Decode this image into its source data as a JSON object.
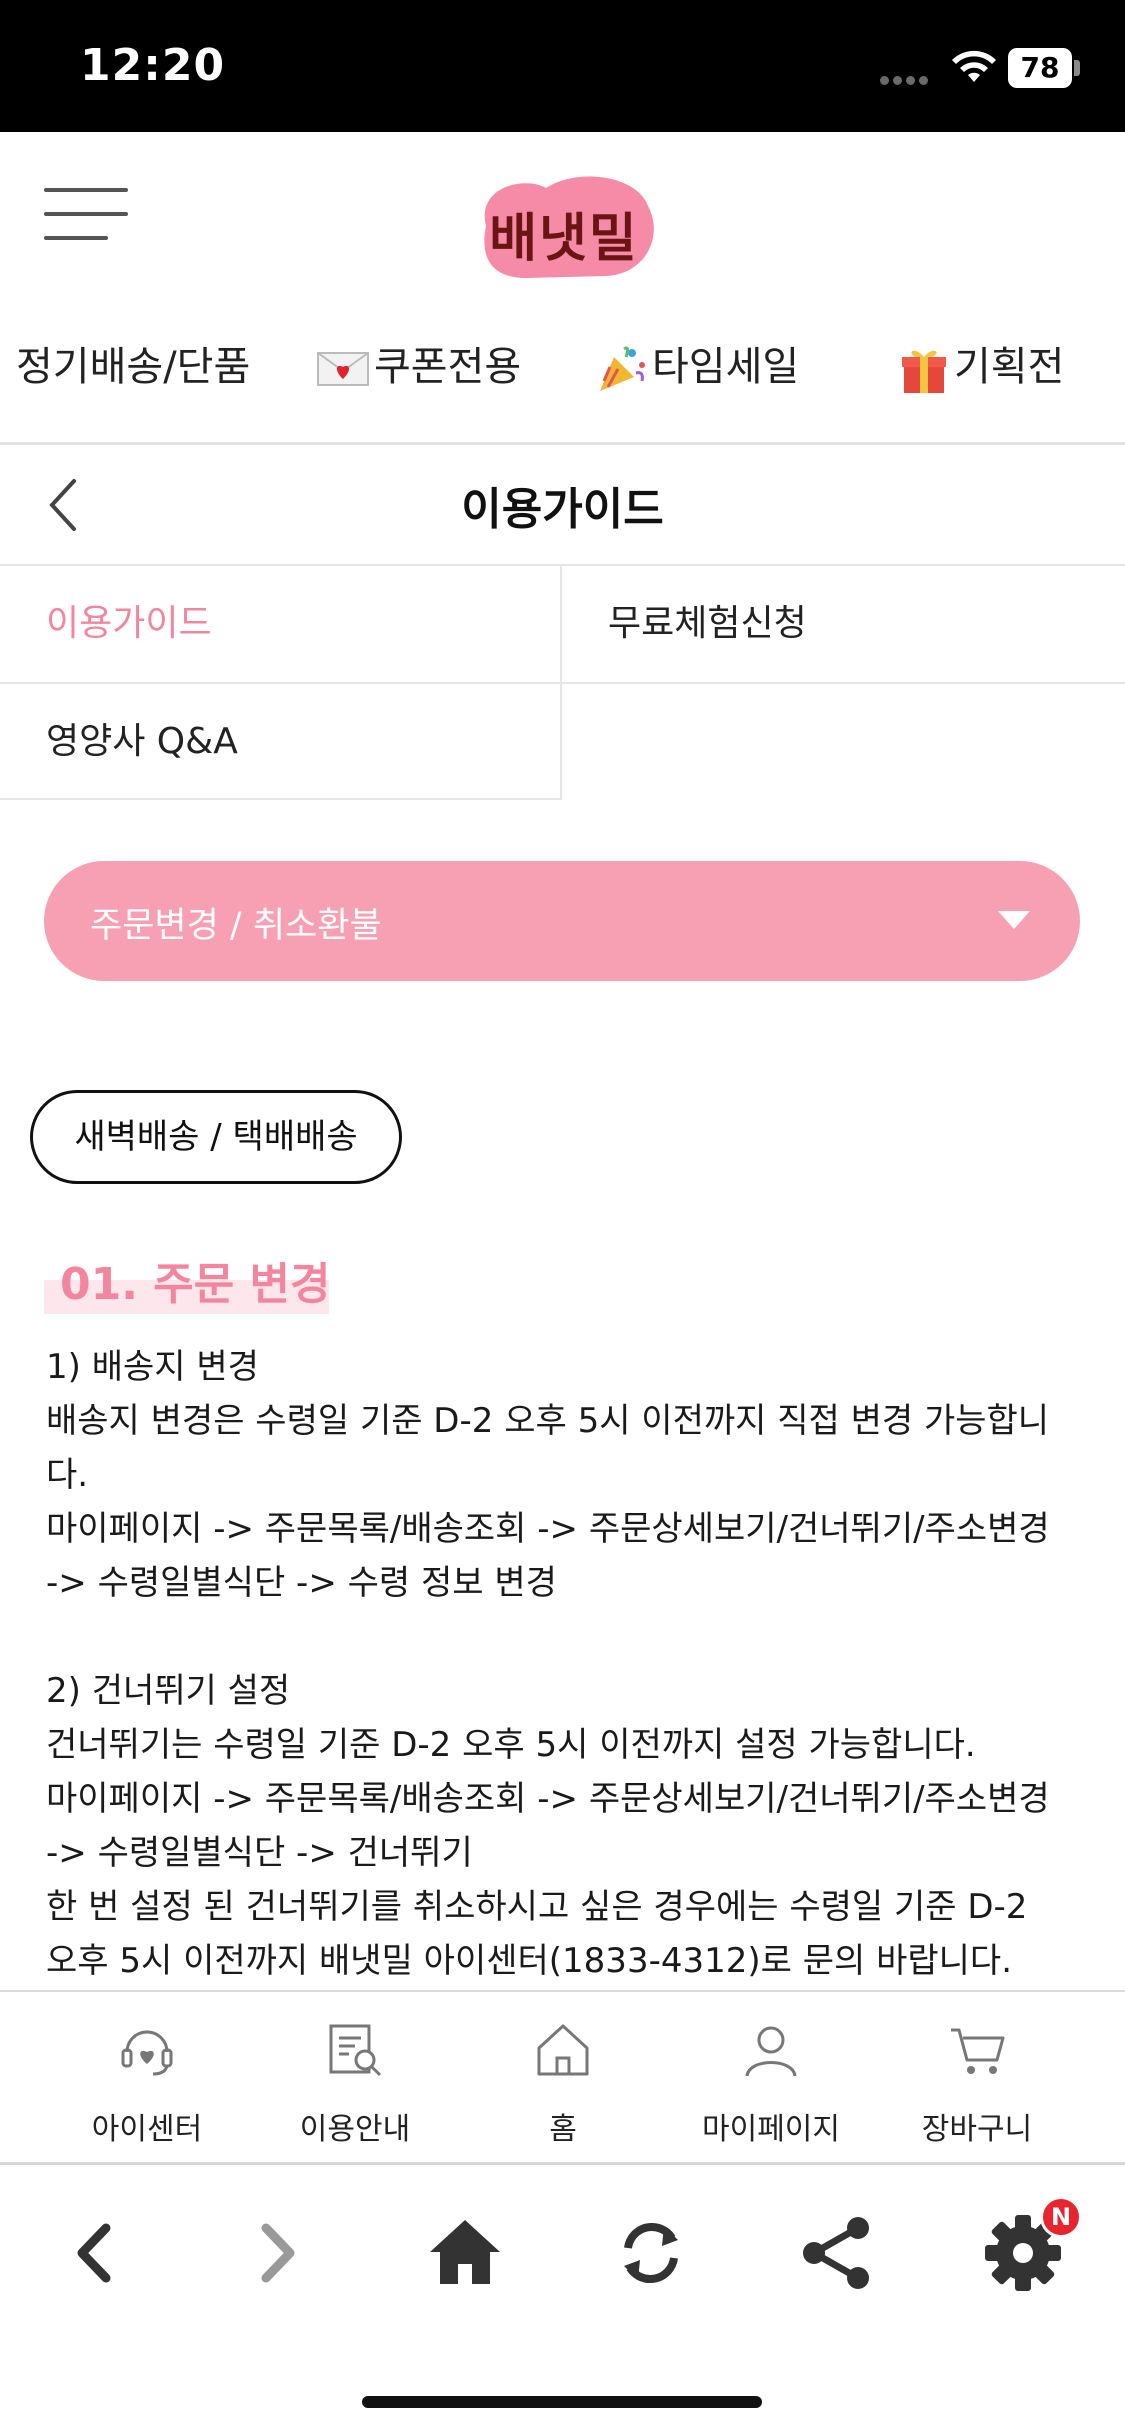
{
  "status_bar": {
    "time": "12:20",
    "battery": "78"
  },
  "header": {
    "logo_text": "배냇밀"
  },
  "category_tabs": [
    {
      "label": "정기배송/단품",
      "icon": ""
    },
    {
      "label": "쿠폰전용",
      "icon": "love-letter-icon"
    },
    {
      "label": "타임세일",
      "icon": "party-popper-icon"
    },
    {
      "label": "기획전",
      "icon": "gift-icon"
    }
  ],
  "page": {
    "title": "이용가이드"
  },
  "submenu": [
    {
      "label": "이용가이드",
      "active": true
    },
    {
      "label": "무료체험신청",
      "active": false
    },
    {
      "label": "영양사 Q&A",
      "active": false
    }
  ],
  "dropdown": {
    "selected": "주문변경 / 취소환불"
  },
  "pill": {
    "label": "새벽배송 / 택배배송"
  },
  "section": {
    "heading": "01. 주문 변경"
  },
  "content_lines": [
    "1) 배송지 변경",
    "배송지 변경은 수령일 기준 D-2 오후 5시 이전까지 직접 변경 가능합니",
    "다.",
    "마이페이지 -> 주문목록/배송조회 -> 주문상세보기/건너뛰기/주소변경",
    "-> 수령일별식단 -> 수령 정보 변경",
    "",
    "2) 건너뛰기 설정",
    "건너뛰기는 수령일 기준 D-2 오후 5시 이전까지 설정 가능합니다.",
    "마이페이지 -> 주문목록/배송조회 -> 주문상세보기/건너뛰기/주소변경",
    "-> 수령일별식단 -> 건너뛰기",
    "한 번 설정 된 건너뛰기를 취소하시고 싶은 경우에는 수령일 기준 D-2",
    "오후 5시 이전까지 배냇밀 아이센터(1833-4312)로 문의 바랍니다."
  ],
  "bottom_nav": [
    {
      "label": "아이센터",
      "icon": "headset-heart-icon"
    },
    {
      "label": "이용안내",
      "icon": "document-search-icon"
    },
    {
      "label": "홈",
      "icon": "house-icon"
    },
    {
      "label": "마이페이지",
      "icon": "person-icon"
    },
    {
      "label": "장바구니",
      "icon": "cart-icon"
    }
  ],
  "browser_toolbar": {
    "badge": "N"
  },
  "colors": {
    "accent_pink": "#f7a0b3",
    "accent_text_pink": "#f3869e",
    "logo_pink": "#f58ba6"
  }
}
